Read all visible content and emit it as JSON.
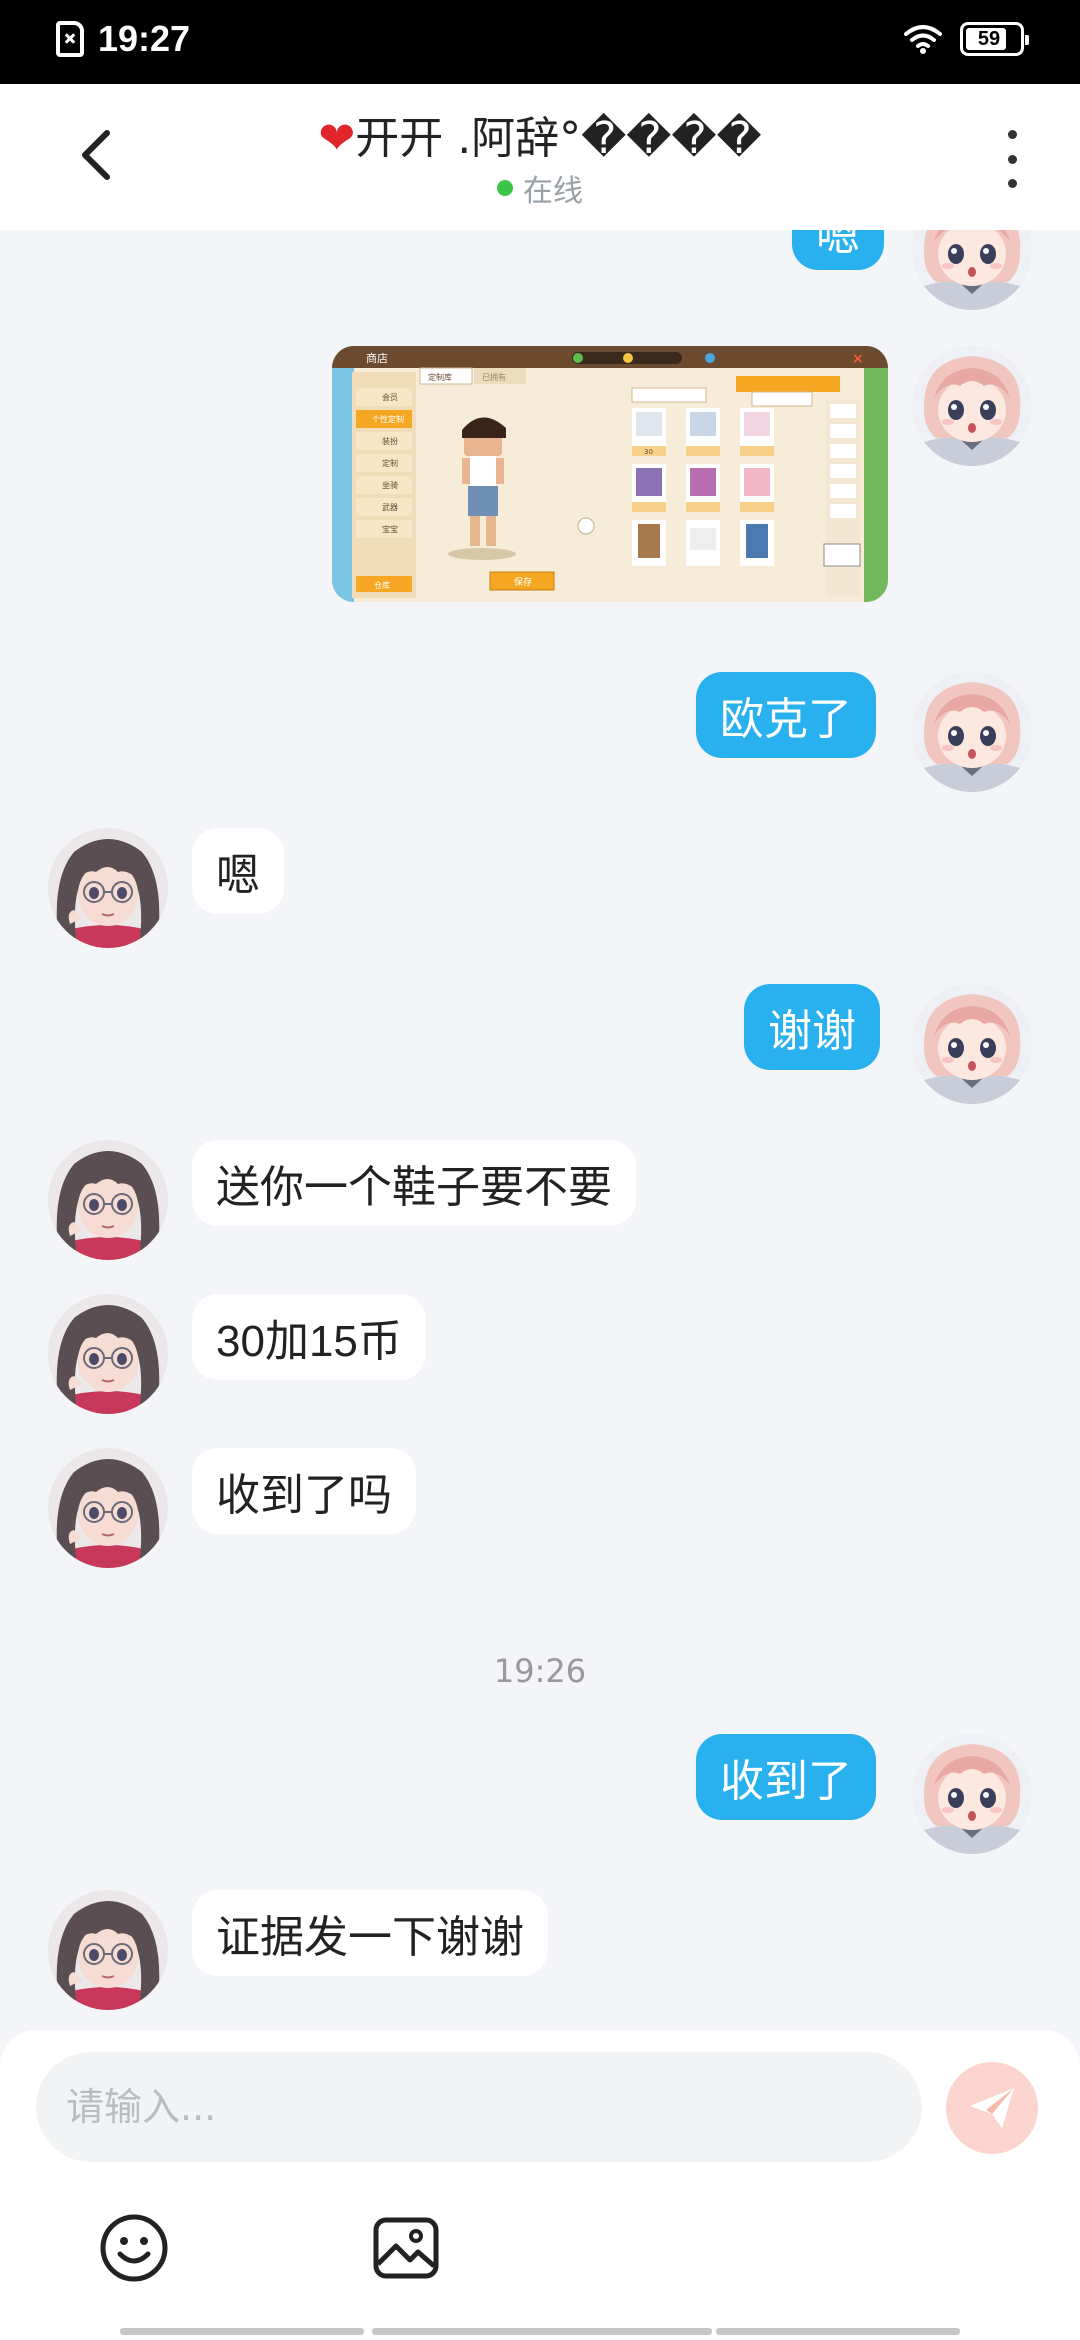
{
  "status_bar": {
    "time": "19:27",
    "battery": "59"
  },
  "header": {
    "title_heart": "❤",
    "title": "开开 .阿辞°����",
    "status": "在线"
  },
  "messages": [
    {
      "side": "mine",
      "text": "嗯"
    },
    {
      "side": "mine",
      "type": "image"
    },
    {
      "side": "mine",
      "text": "欧克了"
    },
    {
      "side": "theirs",
      "text": "嗯"
    },
    {
      "side": "mine",
      "text": "谢谢"
    },
    {
      "side": "theirs",
      "text": "送你一个鞋子要不要"
    },
    {
      "side": "theirs",
      "text": "30加15币"
    },
    {
      "side": "theirs",
      "text": "收到了吗"
    },
    {
      "type": "time",
      "text": "19:26"
    },
    {
      "side": "mine",
      "text": "收到了"
    },
    {
      "side": "theirs",
      "text": "证据发一下谢谢"
    }
  ],
  "shared_image": {
    "tab_custom": "定制库",
    "tab_owned": "已拥有",
    "shop_title": "商店",
    "save_label": "保存",
    "menu": [
      "会员",
      "个性定制",
      "装扮",
      "定制",
      "坐骑",
      "武器",
      "宝宝",
      "仓库"
    ],
    "price": "30"
  },
  "input": {
    "placeholder": "请输入..."
  },
  "colors": {
    "mine_bubble": "#29b0ee",
    "theirs_bubble": "#ffffff",
    "online": "#3cc549",
    "send": "#fbd5cd"
  },
  "icons": {
    "back": "chevron-left-icon",
    "more": "more-vertical-icon",
    "send": "send-icon",
    "emoji": "smiley-icon",
    "image": "image-icon"
  }
}
